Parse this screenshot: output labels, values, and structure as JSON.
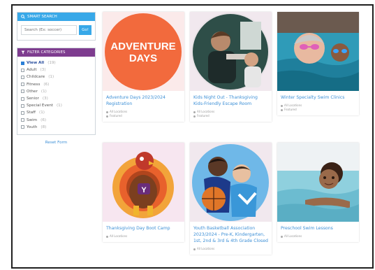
{
  "search": {
    "header_label": "SMART SEARCH",
    "placeholder": "Search (Ex: soccer)",
    "go_label": "Go!"
  },
  "filters": {
    "header_label": "FILTER CATEGORIES",
    "items": [
      {
        "label": "View All",
        "count": "(19)",
        "checked": true
      },
      {
        "label": "Adult",
        "count": "(3)"
      },
      {
        "label": "Childcare",
        "count": "(1)"
      },
      {
        "label": "Fitness",
        "count": "(6)"
      },
      {
        "label": "Other",
        "count": "(1)"
      },
      {
        "label": "Senior",
        "count": "(3)"
      },
      {
        "label": "Special Event",
        "count": "(1)"
      },
      {
        "label": "Staff",
        "count": "(1)"
      },
      {
        "label": "Swim",
        "count": "(6)"
      },
      {
        "label": "Youth",
        "count": "(8)"
      }
    ],
    "reset_label": "Reset Form"
  },
  "cards": [
    {
      "title": "Adventure Days 2023/2024 Registration",
      "location": "All Locations",
      "tag": "Featured",
      "banner_line1": "ADVENTURE",
      "banner_line2": "DAYS"
    },
    {
      "title": "Kids Night Out - Thanksgiving Kids-Friendly Escape Room",
      "location": "All Locations",
      "tag": "Featured"
    },
    {
      "title": "Winter Specialty Swim Clinics",
      "location": "All Locations",
      "tag": "Featured"
    },
    {
      "title": "Thanksgiving Day Boot Camp",
      "location": "All Locations"
    },
    {
      "title": "Youth Basketball Association 2023/2024 - Pre-K, Kindergarten, 1st, 2nd & 3rd & 4th Grade Closed",
      "location": "All Locations"
    },
    {
      "title": "Preschool Swim Lessons",
      "location": "All Locations"
    }
  ],
  "colors": {
    "search_accent": "#38a8e8",
    "filter_accent": "#7e3c8f",
    "link": "#3c8fd6",
    "adventure_orange": "#f26a3d"
  }
}
